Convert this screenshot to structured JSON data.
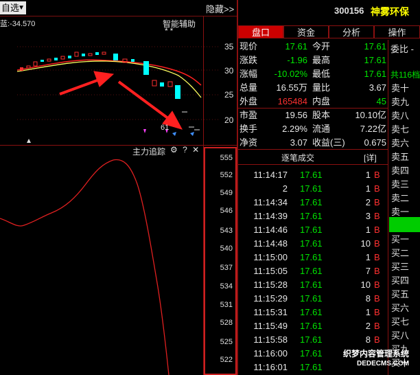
{
  "toolbar": {
    "watchlist_select": "自选",
    "hide_button": "隐藏>>"
  },
  "chart": {
    "indicator_value": "蓝:-34.570",
    "assist_label": "智能辅助",
    "assist_stars": "**",
    "price_scale": [
      "35",
      "30",
      "25",
      "20"
    ],
    "last_price_marker": "61",
    "sub_panel_title": "主力追踪",
    "sub_scale": [
      "555",
      "552",
      "549",
      "546",
      "543",
      "540",
      "537",
      "534",
      "531",
      "528",
      "525",
      "522"
    ],
    "colors": {
      "up": "#ff3030",
      "down": "#00ffff",
      "ma": "#ffff00",
      "arrow": "#ff2020"
    }
  },
  "stock": {
    "code": "300156",
    "name": "神雾环保"
  },
  "tabs": [
    "盘口",
    "资金",
    "分析",
    "操作"
  ],
  "quote": {
    "rows": [
      {
        "l1": "现价",
        "v1": "17.61",
        "c1": "green",
        "l2": "今开",
        "v2": "17.61",
        "c2": "green"
      },
      {
        "l1": "涨跌",
        "v1": "-1.96",
        "c1": "green",
        "l2": "最高",
        "v2": "17.61",
        "c2": "green"
      },
      {
        "l1": "涨幅",
        "v1": "-10.02%",
        "c1": "green",
        "l2": "最低",
        "v2": "17.61",
        "c2": "green"
      },
      {
        "l1": "总量",
        "v1": "16.55万",
        "c1": "white",
        "l2": "量比",
        "v2": "3.67",
        "c2": "white"
      },
      {
        "l1": "外盘",
        "v1": "165484",
        "c1": "red",
        "l2": "内盘",
        "v2": "45",
        "c2": "green"
      },
      {
        "l1": "市盈",
        "v1": "19.56",
        "c1": "white",
        "l2": "股本",
        "v2": "10.10亿",
        "c2": "white"
      },
      {
        "l1": "换手",
        "v1": "2.29%",
        "c1": "white",
        "l2": "流通",
        "v2": "7.22亿",
        "c2": "white"
      },
      {
        "l1": "净资",
        "v1": "3.07",
        "c1": "white",
        "l2": "收益(三)",
        "v2": "0.675",
        "c2": "white"
      }
    ]
  },
  "trades": {
    "title": "逐笔成交",
    "detail_button": "[详]",
    "rows": [
      {
        "time": "11:14:17",
        "price": "17.61",
        "vol": "1",
        "side": "B"
      },
      {
        "time": "2",
        "price": "17.61",
        "vol": "1",
        "side": "B"
      },
      {
        "time": "11:14:34",
        "price": "17.61",
        "vol": "2",
        "side": "B"
      },
      {
        "time": "11:14:39",
        "price": "17.61",
        "vol": "3",
        "side": "B"
      },
      {
        "time": "11:14:46",
        "price": "17.61",
        "vol": "1",
        "side": "B"
      },
      {
        "time": "11:14:48",
        "price": "17.61",
        "vol": "10",
        "side": "B"
      },
      {
        "time": "11:15:00",
        "price": "17.61",
        "vol": "1",
        "side": "B"
      },
      {
        "time": "11:15:05",
        "price": "17.61",
        "vol": "7",
        "side": "B"
      },
      {
        "time": "11:15:28",
        "price": "17.61",
        "vol": "10",
        "side": "B"
      },
      {
        "time": "11:15:29",
        "price": "17.61",
        "vol": "8",
        "side": "B"
      },
      {
        "time": "11:15:31",
        "price": "17.61",
        "vol": "1",
        "side": "B"
      },
      {
        "time": "11:15:49",
        "price": "17.61",
        "vol": "2",
        "side": "B"
      },
      {
        "time": "11:15:58",
        "price": "17.61",
        "vol": "8",
        "side": "B"
      },
      {
        "time": "11:16:00",
        "price": "17.61",
        "vol": "",
        "side": ""
      },
      {
        "time": "11:16:01",
        "price": "17.61",
        "vol": "",
        "side": ""
      }
    ]
  },
  "orderbook": {
    "title": "委比 -",
    "total": "共116档",
    "rows": [
      "卖十",
      "卖九",
      "卖八",
      "卖七",
      "卖六",
      "卖五",
      "卖四",
      "卖三",
      "卖二",
      "卖一",
      "",
      "买一",
      "买二",
      "买三",
      "买四",
      "买五",
      "买六",
      "买七",
      "买八",
      "买九",
      "买十"
    ]
  },
  "watermark": {
    "line1": "织梦内容管理系统",
    "line2": "DEDECMS.COM"
  }
}
